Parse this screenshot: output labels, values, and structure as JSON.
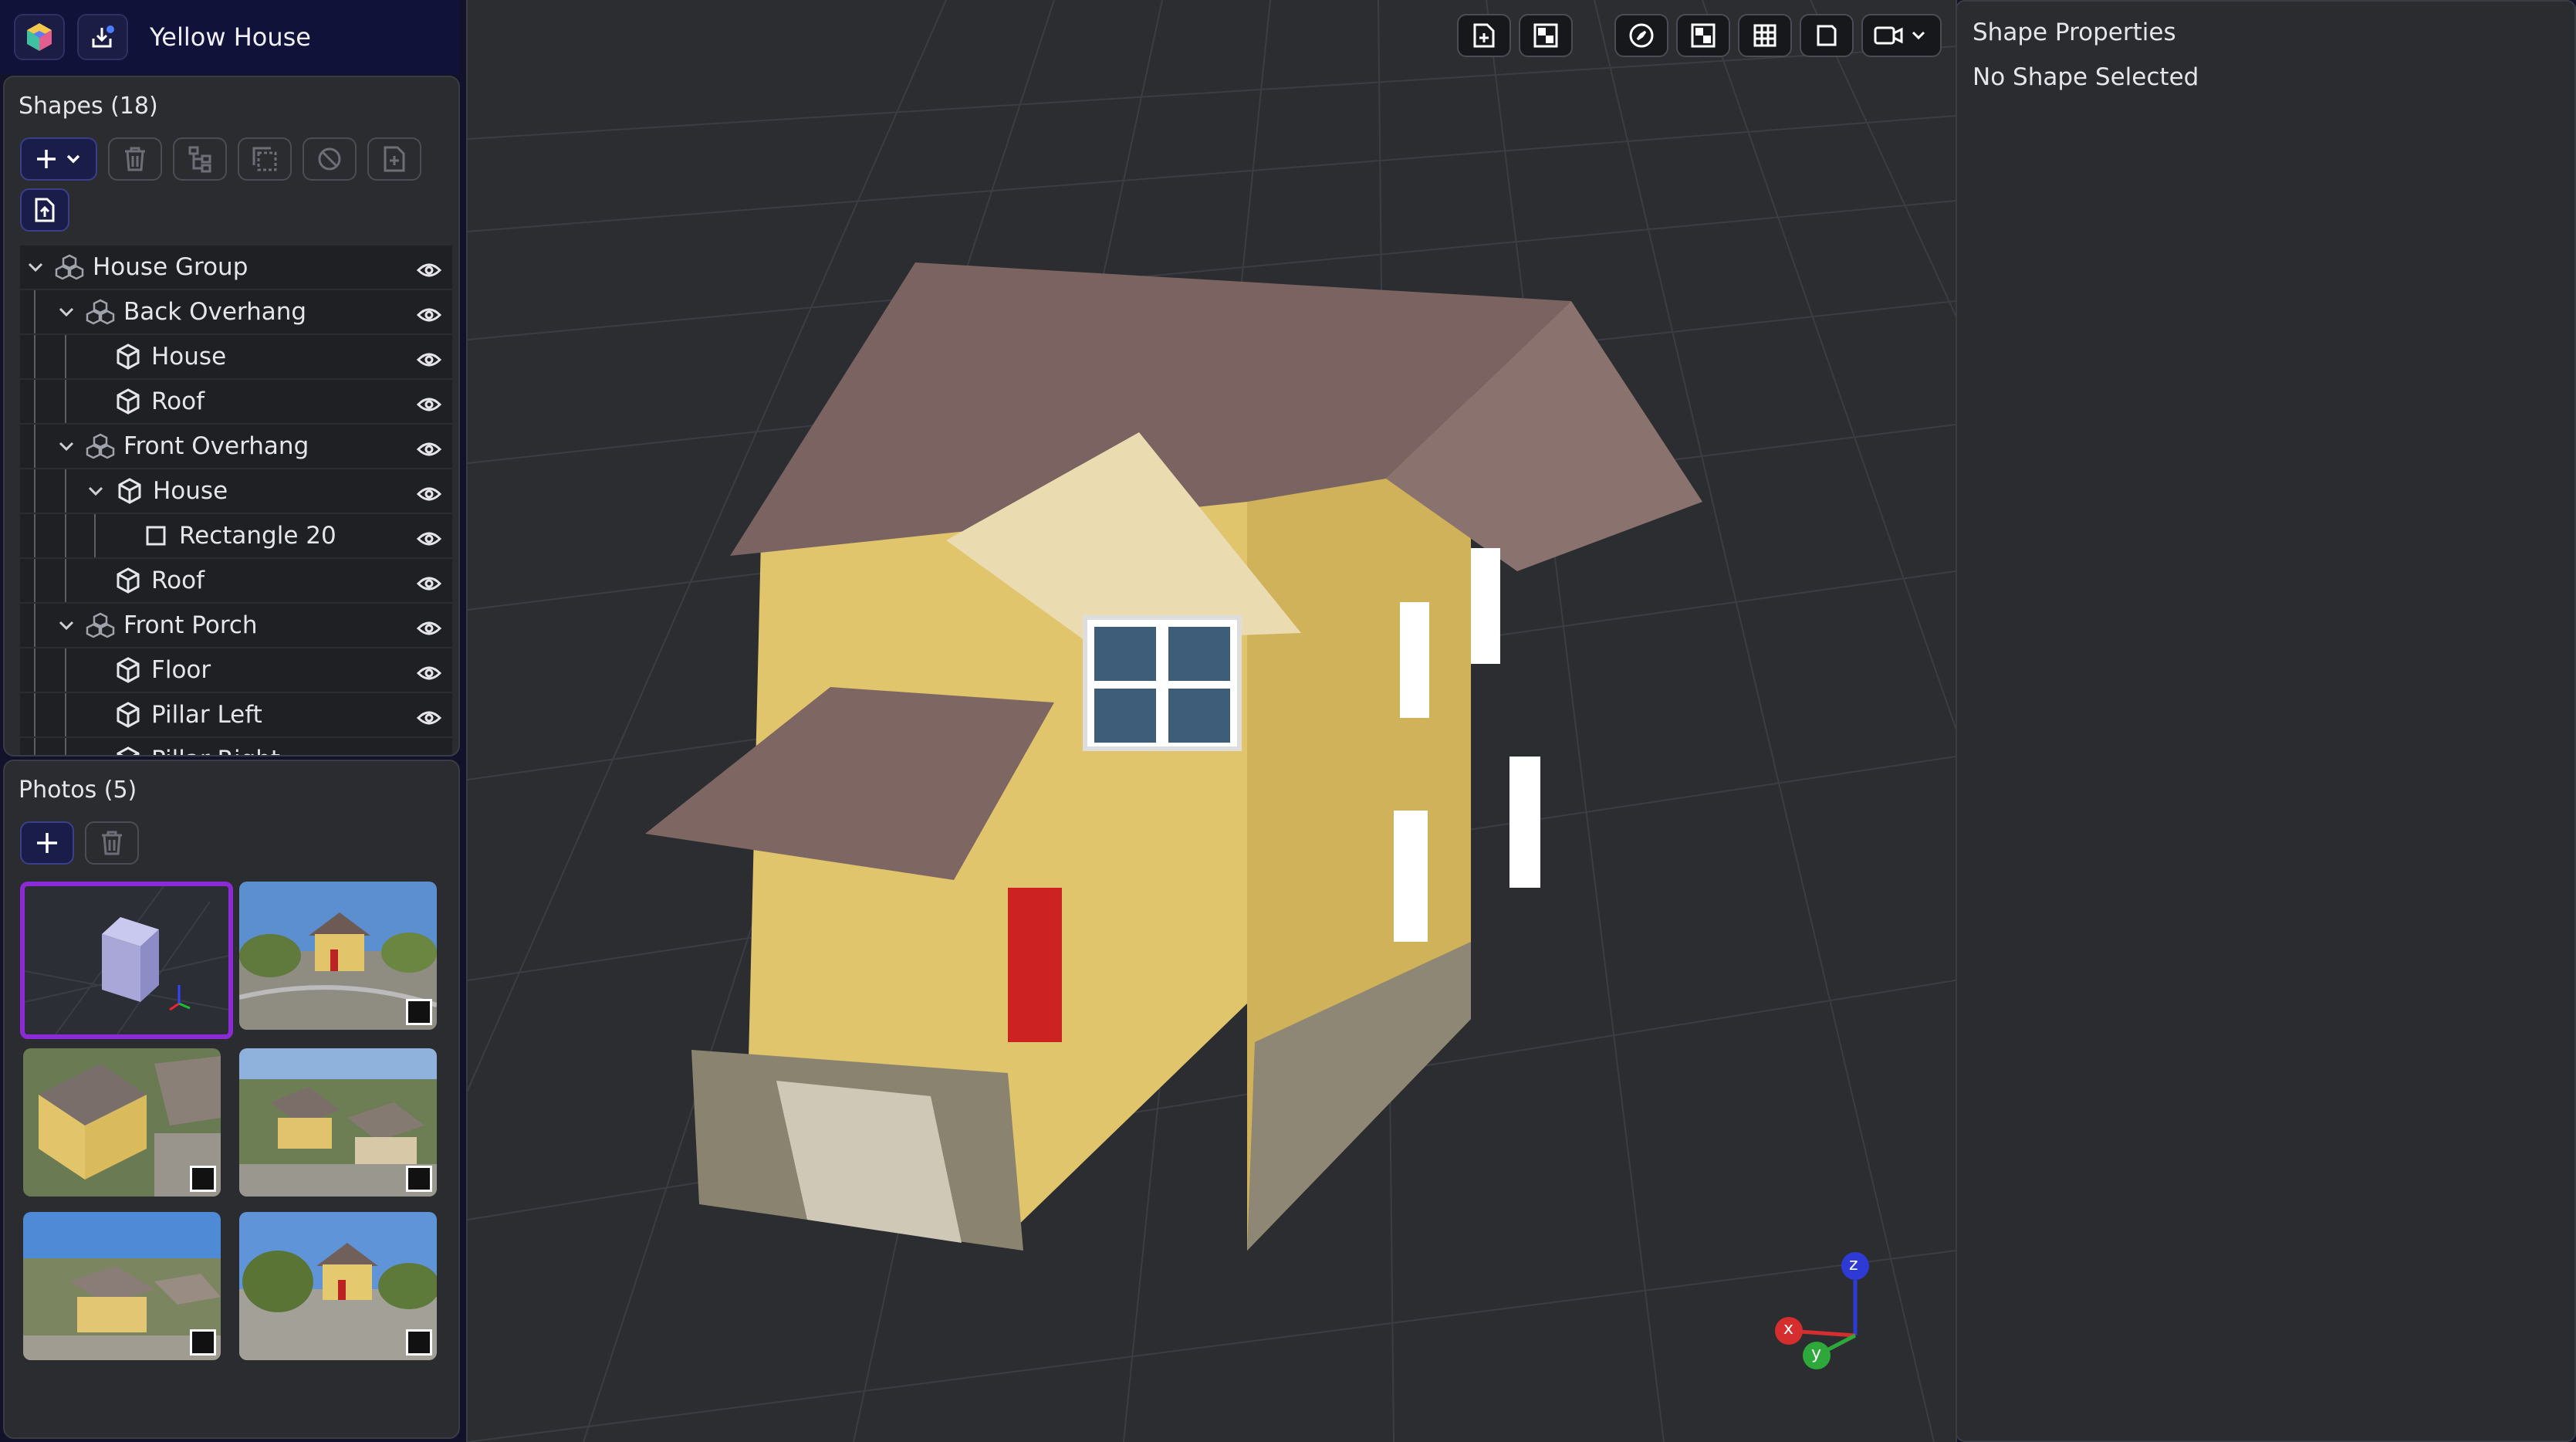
{
  "app": {
    "title": "Yellow House"
  },
  "shapes_panel": {
    "title": "Shapes (18)",
    "tree": [
      {
        "label": "House Group",
        "kind": "group",
        "depth": 0,
        "expanded": true
      },
      {
        "label": "Back Overhang",
        "kind": "group",
        "depth": 1,
        "expanded": true
      },
      {
        "label": "House",
        "kind": "box",
        "depth": 2
      },
      {
        "label": "Roof",
        "kind": "box",
        "depth": 2
      },
      {
        "label": "Front Overhang",
        "kind": "group",
        "depth": 1,
        "expanded": true
      },
      {
        "label": "House",
        "kind": "box",
        "depth": 2,
        "expanded": true
      },
      {
        "label": "Rectangle 20",
        "kind": "rect",
        "depth": 3
      },
      {
        "label": "Roof",
        "kind": "box",
        "depth": 2
      },
      {
        "label": "Front Porch",
        "kind": "group",
        "depth": 1,
        "expanded": true
      },
      {
        "label": "Floor",
        "kind": "box",
        "depth": 2
      },
      {
        "label": "Pillar Left",
        "kind": "box",
        "depth": 2
      },
      {
        "label": "Pillar Right",
        "kind": "box",
        "depth": 2
      }
    ]
  },
  "photos_panel": {
    "title": "Photos (5)",
    "photos": [
      {
        "name": "3d-model-preview",
        "selected": true
      },
      {
        "name": "street-front-view"
      },
      {
        "name": "aerial-side-view"
      },
      {
        "name": "aerial-neighborhood-view"
      },
      {
        "name": "aerial-wide-view"
      },
      {
        "name": "street-corner-view"
      }
    ]
  },
  "properties_panel": {
    "title": "Shape Properties",
    "empty_text": "No Shape Selected"
  },
  "axis": {
    "x": "x",
    "y": "y",
    "z": "z"
  },
  "colors": {
    "accent": "#8a2bd6",
    "panel": "#2b2c30",
    "titlebar": "#10123a",
    "viewport": "#2b2d31"
  }
}
